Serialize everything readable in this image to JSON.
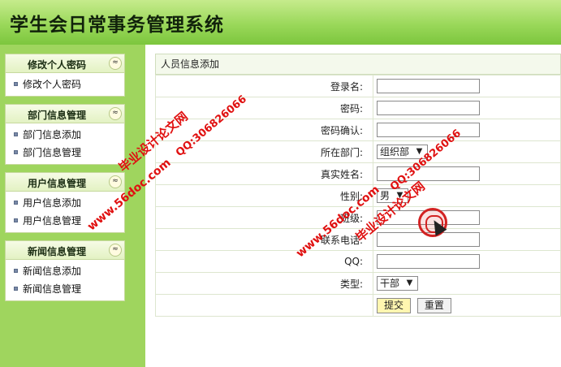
{
  "header": {
    "title": "学生会日常事务管理系统"
  },
  "sidebar": {
    "panels": [
      {
        "title": "修改个人密码",
        "items": [
          "修改个人密码"
        ]
      },
      {
        "title": "部门信息管理",
        "items": [
          "部门信息添加",
          "部门信息管理"
        ]
      },
      {
        "title": "用户信息管理",
        "items": [
          "用户信息添加",
          "用户信息管理"
        ]
      },
      {
        "title": "新闻信息管理",
        "items": [
          "新闻信息添加",
          "新闻信息管理"
        ]
      }
    ],
    "collapse_glyph": "≈"
  },
  "main": {
    "heading": "人员信息添加",
    "fields": {
      "login_name_label": "登录名:",
      "password_label": "密码:",
      "password_confirm_label": "密码确认:",
      "department_label": "所在部门:",
      "department_value": "组织部",
      "real_name_label": "真实姓名:",
      "gender_label": "性别:",
      "gender_value": "男",
      "class_label": "班级:",
      "phone_label": "联系电话:",
      "qq_label": "QQ:",
      "type_label": "类型:",
      "type_value": "干部"
    },
    "buttons": {
      "submit": "提交",
      "reset": "重置"
    }
  },
  "watermarks": {
    "site": "www.56doc.com",
    "qq": "QQ:306826066",
    "brand": "毕业设计论文网"
  },
  "colors": {
    "header_green": "#9ad85a",
    "sidebar_green": "#9fd55e",
    "watermark_red": "#e01010"
  }
}
